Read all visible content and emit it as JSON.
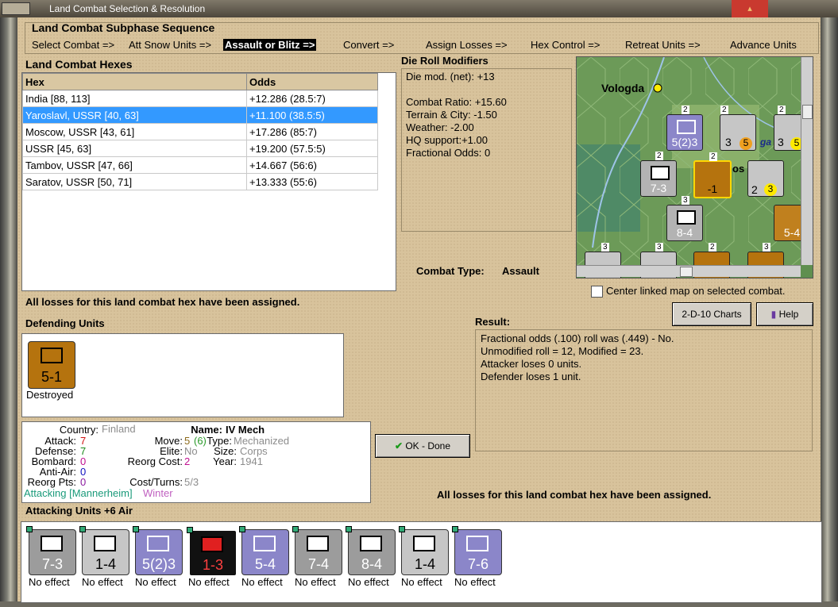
{
  "window": {
    "title": "Land Combat Selection & Resolution"
  },
  "subphase": {
    "heading": "Land Combat Subphase Sequence",
    "steps": [
      "Select Combat =>",
      "Att Snow Units =>",
      "Assault or Blitz =>",
      "Convert =>",
      "Assign Losses =>",
      "Hex Control =>",
      "Retreat Units =>",
      "Advance Units"
    ]
  },
  "hexes": {
    "heading": "Land Combat Hexes",
    "columns": [
      "Hex",
      "Odds"
    ],
    "rows": [
      [
        "India [88, 113]",
        "+12.286 (28.5:7)"
      ],
      [
        "Yaroslavl, USSR [40, 63]",
        "+11.100 (38.5:5)"
      ],
      [
        "Moscow, USSR [43, 61]",
        "+17.286 (85:7)"
      ],
      [
        "USSR [45, 63]",
        "+19.200 (57.5:5)"
      ],
      [
        "Tambov, USSR [47, 66]",
        "+14.667 (56:6)"
      ],
      [
        "Saratov, USSR [50, 71]",
        "+13.333 (55:6)"
      ]
    ]
  },
  "die": {
    "heading": "Die Roll Modifiers",
    "lines": [
      "Die mod. (net): +13",
      "",
      "Combat Ratio: +15.60",
      "Terrain & City: -1.50",
      "Weather: -2.00",
      "HQ support:+1.00",
      "Fractional Odds: 0"
    ]
  },
  "map": {
    "city": "Vologda",
    "label_os": "os",
    "label_ga": "ga",
    "units": [
      {
        "str": "5(2)3",
        "stack": "2"
      },
      {
        "str": "3",
        "str2": "5",
        "stack": "2"
      },
      {
        "str": "3",
        "str2": "5",
        "stack": "2"
      },
      {
        "str": "7-3",
        "stack": "2"
      },
      {
        "str": "-1",
        "stack": "2"
      },
      {
        "str": "2",
        "str2": "3",
        "stack": ""
      },
      {
        "str": "8-4",
        "stack": "3"
      },
      {
        "str": "5-4",
        "stack": ""
      }
    ],
    "bottom_stacks": [
      "3",
      "3",
      "2",
      "3"
    ]
  },
  "combat_type": {
    "label": "Combat Type:",
    "value": "Assault"
  },
  "center_map": {
    "label": "Center linked map on selected combat."
  },
  "losses_msg_1": "All losses for this land combat hex have been assigned.",
  "losses_msg_2": "All losses for this land combat hex have been assigned.",
  "buttons": {
    "charts": "2-D-10 Charts",
    "help": "Help",
    "ok": "OK - Done"
  },
  "result": {
    "heading": "Result:",
    "lines": [
      "Fractional odds (.100) roll was (.449)  - No.",
      "Unmodified roll = 12, Modified = 23.",
      "Attacker loses 0 units.",
      "Defender loses 1 unit."
    ]
  },
  "defending": {
    "heading": "Defending Units",
    "unit": {
      "str": "5-1",
      "status": "Destroyed"
    }
  },
  "info": {
    "country_label": "Country:",
    "country": "Finland",
    "attack_label": "Attack:",
    "attack": "7",
    "defense_label": "Defense:",
    "defense": "7",
    "bombard_label": "Bombard:",
    "bombard": "0",
    "antiair_label": "Anti-Air:",
    "antiair": "0",
    "reorgpts_label": "Reorg Pts:",
    "reorgpts": "0",
    "name_label": "Name:",
    "name": "IV Mech",
    "move_label": "Move:",
    "move": "5",
    "move_extra": "(6)",
    "type_label": "Type:",
    "type": "Mechanized",
    "elite_label": "Elite:",
    "elite": "No",
    "size_label": "Size:",
    "size": "Corps",
    "reorgcost_label": "Reorg Cost:",
    "reorgcost": "2",
    "year_label": "Year:",
    "year": "1941",
    "costturns_label": "Cost/Turns:",
    "costturns": "5/3",
    "attacking": "Attacking [Mannerheim]",
    "weather": "Winter"
  },
  "attacking": {
    "heading": "Attacking Units +6 Air",
    "units": [
      {
        "str": "7-3",
        "status": "No effect",
        "color": "#9c9c9c"
      },
      {
        "str": "1-4",
        "status": "No effect",
        "color": "#c6c6c6"
      },
      {
        "str": "5(2)3",
        "status": "No effect",
        "color": "#8b86c9"
      },
      {
        "str": "1-3",
        "status": "No effect",
        "color": "#111111"
      },
      {
        "str": "5-4",
        "status": "No effect",
        "color": "#8b86c9"
      },
      {
        "str": "7-4",
        "status": "No effect",
        "color": "#9c9c9c"
      },
      {
        "str": "8-4",
        "status": "No effect",
        "color": "#9c9c9c"
      },
      {
        "str": "1-4",
        "status": "No effect",
        "color": "#c6c6c6"
      },
      {
        "str": "7-6",
        "status": "No effect",
        "color": "#8b86c9"
      }
    ]
  }
}
